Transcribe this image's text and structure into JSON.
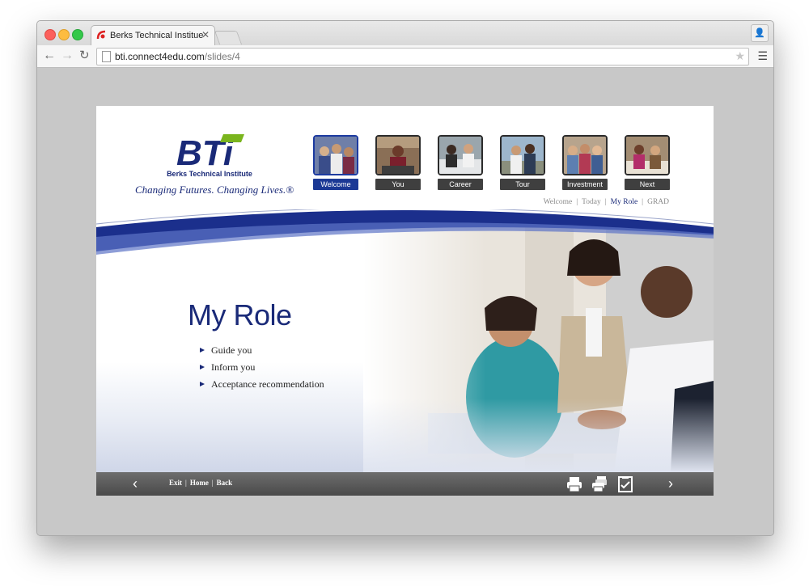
{
  "browser": {
    "tab_title": "Berks Technical Institue",
    "tab_close": "✕",
    "url_host": "bti.connect4edu.com",
    "url_path": "/slides/4",
    "back_glyph": "←",
    "forward_glyph": "→",
    "reload_glyph": "↻",
    "star_glyph": "★",
    "menu_glyph": "☰",
    "profile_glyph": "👤"
  },
  "brand": {
    "logo_text": "BTi",
    "name": "Berks Technical Institute",
    "tagline": "Changing Futures. Changing Lives.®",
    "color": "#1a2a78",
    "accent": "#7ab51d"
  },
  "nav": {
    "items": [
      {
        "label": "Welcome",
        "active": true
      },
      {
        "label": "You",
        "active": false
      },
      {
        "label": "Career",
        "active": false
      },
      {
        "label": "Tour",
        "active": false
      },
      {
        "label": "Investment",
        "active": false
      },
      {
        "label": "Next",
        "active": false
      }
    ]
  },
  "breadcrumbs": {
    "items": [
      "Welcome",
      "Today",
      "My Role",
      "GRAD"
    ],
    "separator": "|",
    "current": "My Role"
  },
  "slide": {
    "title": "My Role",
    "bullets": [
      "Guide you",
      "Inform you",
      "Acceptance recommendation"
    ]
  },
  "footer": {
    "prev_glyph": "‹",
    "next_glyph": "›",
    "links": [
      "Exit",
      "Home",
      "Back"
    ],
    "separator": "|",
    "icons": [
      "print-icon",
      "print-all-icon",
      "checklist-icon"
    ]
  }
}
